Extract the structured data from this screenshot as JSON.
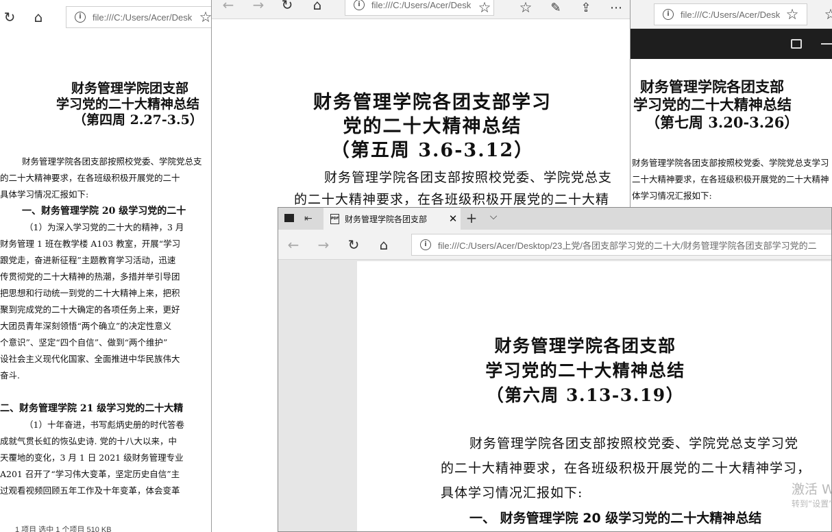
{
  "win_left": {
    "address": "file:///C:/Users/Acer/Desk",
    "title_lines": [
      "财务管理学院团支部",
      "学习党的二十大精神总结",
      "（第四周 2.27-3.5）"
    ],
    "intro_lines": [
      "财务管理学院各团支部按照校党委、学院党总支",
      "的二十大精神要求，在各班级积极开展党的二十",
      "具体学习情况汇报如下:"
    ],
    "heading1": "一、财务管理学院 20 级学习党的二十",
    "body1": [
      "（1）为深入学习党的二十大的精神，3 月",
      "财务管理 1 班在教学楼 A103 教室，开展“学习",
      "跟党走，奋进新征程”主题教育学习活动，迅速",
      "传贯彻党的二十大精神的热潮，多措并举引导团",
      "把思想和行动统一到党的二十大精神上来，把积",
      "聚到完成党的二十大确定的各项任务上来，更好",
      "大团员青年深刻领悟“两个确立”的决定性意义",
      "个意识”、坚定“四个自信”、做到“两个维护”",
      "设社会主义现代化国家、全面推进中华民族伟大",
      "奋斗."
    ],
    "heading2": "二、财务管理学院 21 级学习党的二十大精",
    "body2": [
      "（1）十年奋进，书写彪炳史册的时代答卷",
      "成就气贯长虹的恢弘史诗. 党的十八大以来，中",
      "天覆地的变化，3 月 1 日 2021 级财务管理专业",
      "A201 召开了“学习伟大变革，坚定历史自信”主",
      "过观看视频回顾五年工作及十年变革，体会变革"
    ],
    "status": "1 项目    选中 1 个项目  510 KB"
  },
  "win_mid": {
    "address": "file:///C:/Users/Acer/Desk",
    "title_lines": [
      "财务管理学院各团支部学习",
      "党的二十大精神总结",
      "（第五周 3.6-3.12）"
    ],
    "intro_lines": [
      "财务管理学院各团支部按照校党委、学院党总支",
      "的二十大精神要求，在各班级积极开展党的二十大精"
    ]
  },
  "win_right": {
    "address": "file:///C:/Users/Acer/Desk",
    "title_lines": [
      "财务管理学院各团支部",
      "学习党的二十大精神总结",
      "（第七周 3.20-3.26）"
    ],
    "intro_lines": [
      "财务管理学院各团支部按照校党委、学院党总支学习",
      "二十大精神要求，在各班级积极开展党的二十大精神",
      "体学习情况汇报如下:"
    ]
  },
  "win_front": {
    "tab_label": "财务管理学院各团支部",
    "address": "file:///C:/Users/Acer/Desktop/23上党/各团支部学习党的二十大/财务管理学院各团支部学习党的二",
    "title_lines": [
      "财务管理学院各团支部",
      "学习党的二十大精神总结",
      "（第六周 3.13-3.19）"
    ],
    "intro_lines": [
      "财务管理学院各团支部按照校党委、学院党总支学习党",
      "的二十大精神要求，在各班级积极开展党的二十大精神学习，",
      "具体学习情况汇报如下:"
    ],
    "heading1": "一、 财务管理学院 20 级学习党的二十大精神总结",
    "watermark_line1": "激活 W",
    "watermark_line2": "转到“设置”"
  },
  "icons": [
    "refresh-icon",
    "home-icon",
    "back-icon",
    "forward-icon",
    "star-icon",
    "favorites-icon",
    "pen-icon",
    "share-icon",
    "more-icon",
    "fullscreen-icon",
    "minimize-icon",
    "tab-preview-icon",
    "set-aside-icon",
    "pdf-icon",
    "close-icon",
    "new-tab-icon",
    "tab-list-icon"
  ]
}
